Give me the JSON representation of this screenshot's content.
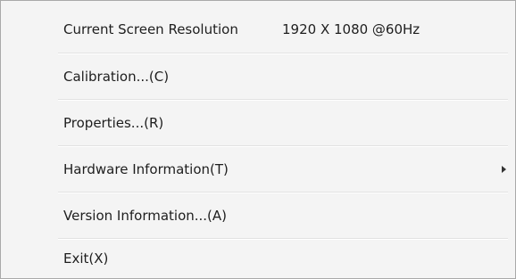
{
  "menu": {
    "items": [
      {
        "label": "Current Screen Resolution",
        "value": "1920 X 1080 @60Hz"
      },
      {
        "label": "Calibration...(C)"
      },
      {
        "label": "Properties...(R)"
      },
      {
        "label": "Hardware Information(T)",
        "submenu": true
      },
      {
        "label": "Version Information...(A)"
      },
      {
        "label": "Exit(X)"
      }
    ]
  },
  "icons": {
    "submenu_arrow": "chevron-right-icon"
  }
}
